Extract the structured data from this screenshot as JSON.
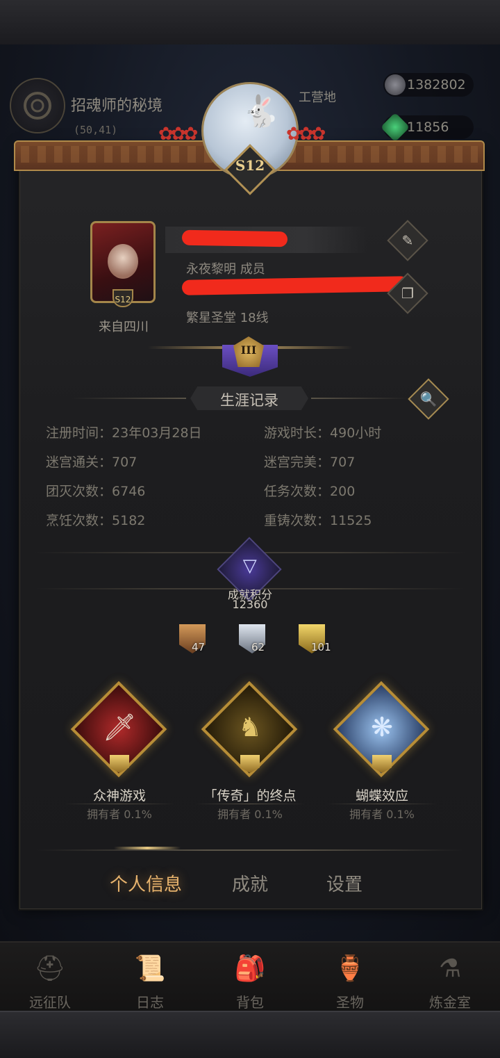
{
  "background": {
    "zone_title": "招魂师的秘境",
    "zone_coords": "(50,41)",
    "camp_label": "工营地",
    "currency_1": "1382802",
    "currency_2": "11856"
  },
  "profile": {
    "season_badge": "S12",
    "avatar_badge": "S12",
    "origin": "来自四川",
    "guild_line": "永夜黎明 成员",
    "server_line": "繁星圣堂 18线",
    "rank_numeral": "III"
  },
  "career": {
    "section_title": "生涯记录",
    "stats": [
      {
        "label": "注册时间：",
        "value": "23年03月28日"
      },
      {
        "label": "游戏时长：",
        "value": "490小时"
      },
      {
        "label": "迷宫通关：",
        "value": "707"
      },
      {
        "label": "迷宫完美：",
        "value": "707"
      },
      {
        "label": "团灭次数：",
        "value": "6746"
      },
      {
        "label": "任务次数：",
        "value": "200"
      },
      {
        "label": "烹饪次数：",
        "value": "5182"
      },
      {
        "label": "重铸次数：",
        "value": "11525"
      }
    ]
  },
  "achievements": {
    "score_label": "成就积分",
    "score_value": "12360",
    "tiers": [
      {
        "tier": "bronze",
        "count": "47"
      },
      {
        "tier": "silver",
        "count": "62"
      },
      {
        "tier": "gold",
        "count": "101"
      }
    ],
    "featured": [
      {
        "title": "众神游戏",
        "owners": "拥有者 0.1%",
        "icon": "sword-icon"
      },
      {
        "title": "「传奇」的终点",
        "owners": "拥有者 0.1%",
        "icon": "golden-statue-icon"
      },
      {
        "title": "蝴蝶效应",
        "owners": "拥有者 0.1%",
        "icon": "butterfly-icon"
      }
    ]
  },
  "tabs": [
    "个人信息",
    "成就",
    "设置"
  ],
  "bottom_nav": [
    {
      "label": "远征队",
      "icon": "helmet-icon"
    },
    {
      "label": "日志",
      "icon": "scroll-icon"
    },
    {
      "label": "背包",
      "icon": "backpack-icon"
    },
    {
      "label": "圣物",
      "icon": "relic-icon"
    },
    {
      "label": "炼金室",
      "icon": "alchemy-icon"
    }
  ],
  "colors": {
    "accent_tab": "#e7b36d",
    "frame_gold": "#b78d37",
    "redaction": "#f12a1c"
  }
}
